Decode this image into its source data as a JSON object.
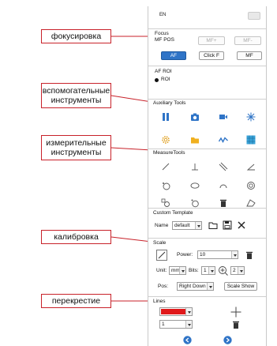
{
  "callouts": {
    "focus": "фокусировка",
    "aux": "вспомогательные инструменты",
    "measure": "измерительные инструменты",
    "calib": "калибровка",
    "cross": "перекрестие"
  },
  "header": {
    "lang": "EN"
  },
  "focus": {
    "title": "Focus",
    "mf_pos": "MF POS",
    "mf_plus": "MF+",
    "mf_minus": "MF-",
    "af": "AF",
    "click_f": "Click F",
    "mf": "MF"
  },
  "af_roi": {
    "title": "AF ROI",
    "option": "ROI"
  },
  "aux": {
    "title": "Auxiliary Tools"
  },
  "measure": {
    "title": "MeasureTools"
  },
  "template": {
    "title": "Custom Template",
    "name_label": "Name",
    "name_value": "default"
  },
  "scale": {
    "title": "Scale",
    "power_label": "Power:",
    "power_value": "10",
    "unit_label": "Unit:",
    "unit_value": "mm",
    "bits_label": "Bits:",
    "bits_value": "1",
    "zoom_value": "2",
    "pos_label": "Pos:",
    "pos_value": "Right Down",
    "scale_show": "Scale Show"
  },
  "lines": {
    "title": "Lines",
    "width_value": "1",
    "color": "#e0191b"
  },
  "colors": {
    "accent": "#2f74c7",
    "callout_border": "#c8222a"
  },
  "icons": {
    "aux": [
      "pause-icon",
      "camera-icon",
      "video-icon",
      "snowflake-icon",
      "settings-icon",
      "folder-icon",
      "waveform-icon",
      "grid-icon"
    ],
    "measure": [
      "line-icon",
      "perpendicular-icon",
      "parallel-icon",
      "angle-icon",
      "circle-3pt-icon",
      "circle-ellipse-icon",
      "arc-icon",
      "concentric-icon",
      "rect-circle-icon",
      "circle-point-icon",
      "delete-icon",
      "polygon-icon"
    ]
  }
}
